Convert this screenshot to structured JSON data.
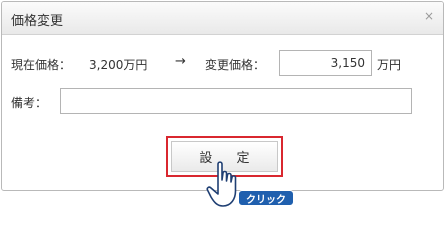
{
  "dialog": {
    "title": "価格変更",
    "close_glyph": "×"
  },
  "form": {
    "current_price_label": "現在価格：",
    "current_price_value": "3,200万円",
    "arrow": "→",
    "new_price_label": "変更価格：",
    "new_price_value": "3,150",
    "new_price_unit": "万円",
    "memo_label": "備考：",
    "memo_value": ""
  },
  "actions": {
    "submit_label": "設 定"
  },
  "overlay": {
    "click_label": "クリック",
    "cursor_icon": "hand-pointer-icon"
  },
  "colors": {
    "highlight": "#d9272f",
    "badge": "#1f5fae"
  }
}
